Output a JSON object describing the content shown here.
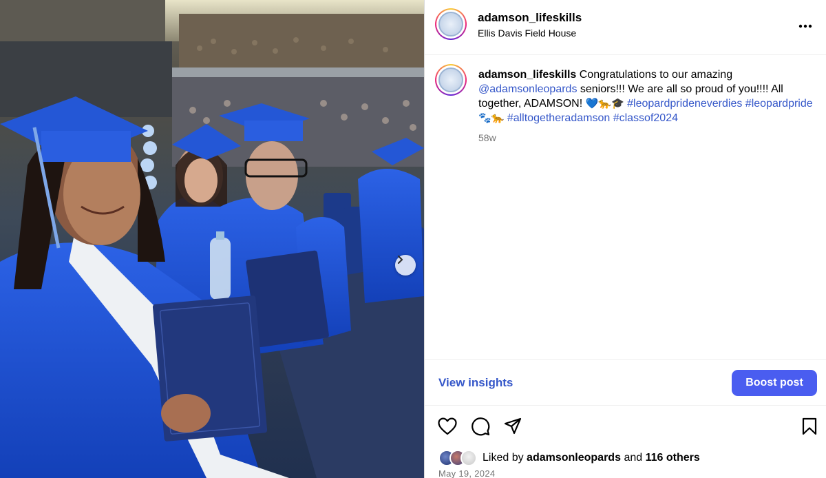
{
  "media": {
    "description_icon": "graduation-photo",
    "next_icon": "chevron-right-icon"
  },
  "header": {
    "username": "adamson_lifeskills",
    "location": "Ellis Davis Field House",
    "more_icon": "more-horizontal-icon"
  },
  "caption": {
    "username": "adamson_lifeskills",
    "text_1": " Congratulations to our amazing ",
    "mention": "@adamsonleopards",
    "text_2": " seniors!!! We are all so proud of you!!!! All together, ADAMSON! ",
    "emoji_1": "💙🐆🎓",
    "hashtag_1": "#leopardprideneverdies",
    "hashtag_2": "#leopardpride",
    "emoji_2": "🐾🐆",
    "hashtag_3": "#alltogetheradamson",
    "hashtag_4": "#classof2024",
    "time_ago": "58w"
  },
  "insights": {
    "view_label": "View insights",
    "boost_label": "Boost post"
  },
  "actions": {
    "like_icon": "heart-icon",
    "comment_icon": "comment-icon",
    "share_icon": "share-icon",
    "save_icon": "bookmark-icon"
  },
  "likes": {
    "prefix": "Liked by ",
    "user": "adamsonleopards",
    "middle": " and ",
    "others": "116 others"
  },
  "date": "May 19, 2024",
  "colors": {
    "link": "#3557c9",
    "boost": "#4a5df0",
    "gown_blue": "#1f4fd1"
  }
}
